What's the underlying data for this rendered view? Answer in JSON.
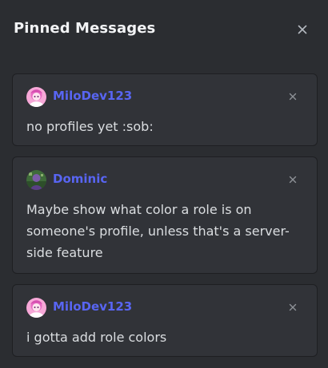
{
  "header": {
    "title": "Pinned Messages",
    "close_icon": "close-icon"
  },
  "pins": [
    {
      "author": "MiloDev123",
      "avatar": "pink-anime-avatar",
      "content": "no profiles yet :sob:"
    },
    {
      "author": "Dominic",
      "avatar": "green-purple-avatar",
      "content": "Maybe show what color a role is on someone's profile, unless that's a server-side feature"
    },
    {
      "author": "MiloDev123",
      "avatar": "pink-anime-avatar",
      "content": "i gotta add role colors"
    }
  ],
  "colors": {
    "background": "#2b2d31",
    "card": "#313338",
    "author": "#5865f2",
    "text": "#dbdee1"
  }
}
